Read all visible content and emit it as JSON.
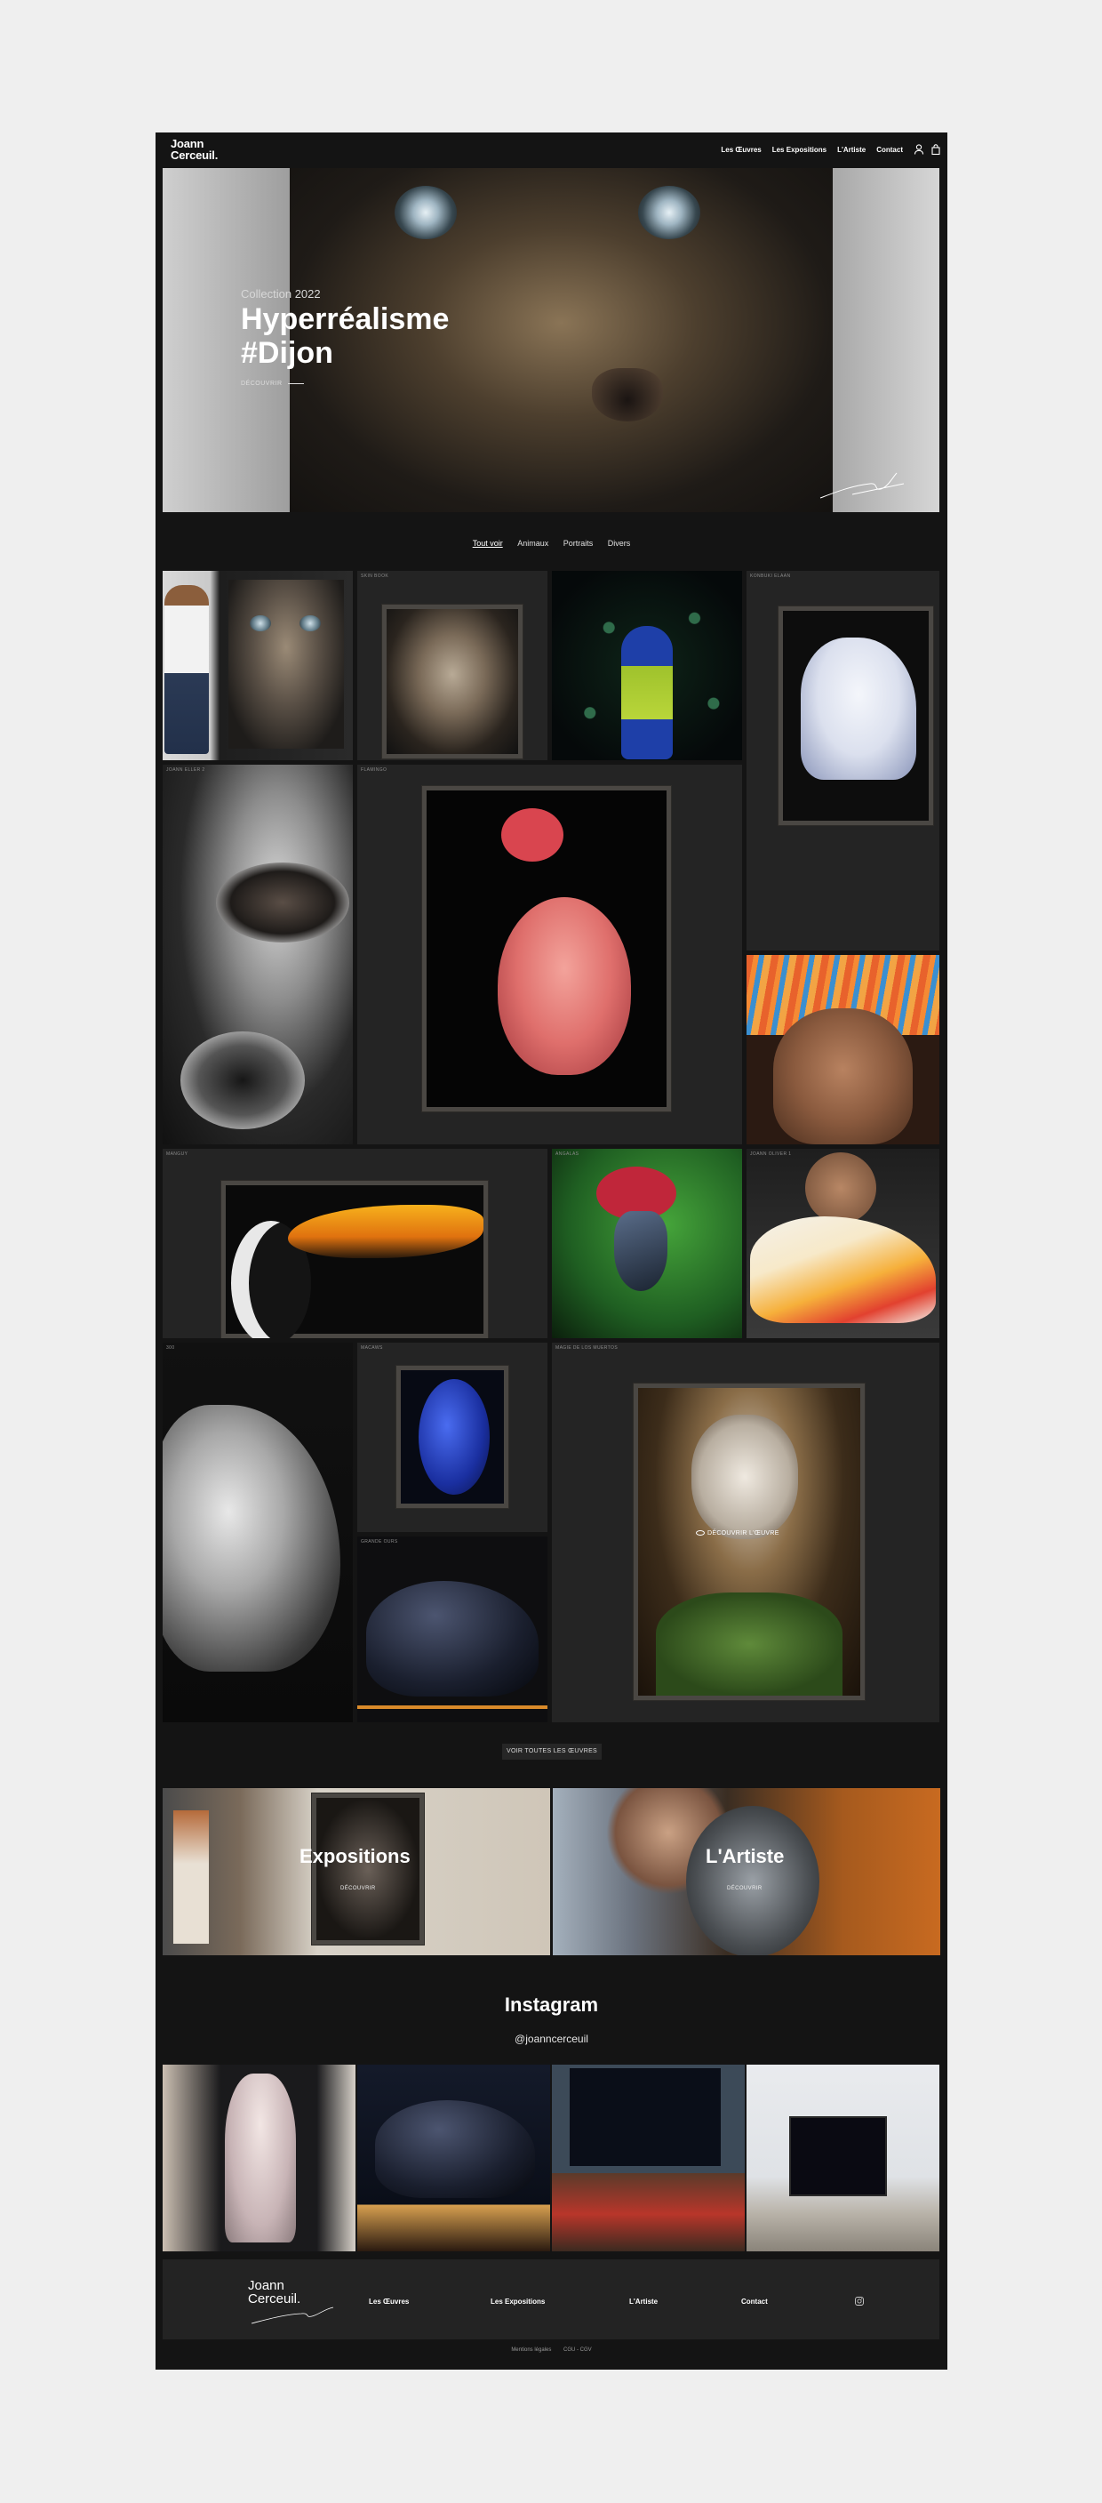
{
  "header": {
    "logo_line1": "Joann",
    "logo_line2": "Cerceuil.",
    "nav": [
      "Les Œuvres",
      "Les Expositions",
      "L'Artiste",
      "Contact"
    ]
  },
  "hero": {
    "kicker": "Collection 2022",
    "title_line1": "Hyperréalisme",
    "title_line2": "#Dijon",
    "cta": "DÉCOUVRIR"
  },
  "filters": [
    "Tout voir",
    "Animaux",
    "Portraits",
    "Divers"
  ],
  "gallery": {
    "labels": {
      "old_woman": "SKIN BOOK",
      "bear": "KONBUKI ELAAN",
      "woman_eye": "JOANN ELLER 2",
      "flamingo": "FLAMINGO",
      "toucan": "MANGUY",
      "parrot": "ANGALAS",
      "sneaker": "JOANN OLIVER 1",
      "car": "300",
      "hyacinth": "MACAWS",
      "black_bear": "GRANDE OURS",
      "catrina": "MAGIE DE LOS MUERTOS"
    },
    "hover_label": "DÉCOUVRIR L'ŒUVRE",
    "view_all": "VOIR TOUTES LES ŒUVRES"
  },
  "promos": [
    {
      "title": "Expositions",
      "cta": "DÉCOUVRIR"
    },
    {
      "title": "L'Artiste",
      "cta": "DÉCOUVRIR"
    }
  ],
  "instagram": {
    "title": "Instagram",
    "handle": "@joanncerceuil"
  },
  "footer": {
    "logo_line1": "Joann",
    "logo_line2": "Cerceuil.",
    "nav": [
      "Les Œuvres",
      "Les Expositions",
      "L'Artiste",
      "Contact"
    ],
    "legal": [
      "Mentions légales",
      "CGU - CGV"
    ]
  },
  "colors": {
    "page_bg": "#141414",
    "tile_bg": "#242424",
    "outer_bg": "#efefef"
  }
}
